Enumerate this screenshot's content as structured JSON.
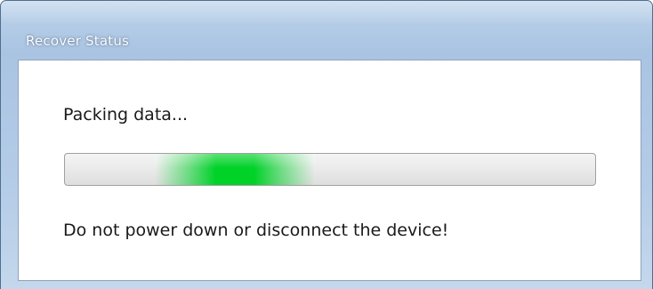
{
  "window": {
    "title": "Recover Status"
  },
  "status": {
    "label": "Packing data...",
    "warning": "Do not power down or disconnect the device!"
  },
  "progress": {
    "mode": "indeterminate-marquee",
    "marquee_position": 0.22,
    "color": "#00d228"
  }
}
